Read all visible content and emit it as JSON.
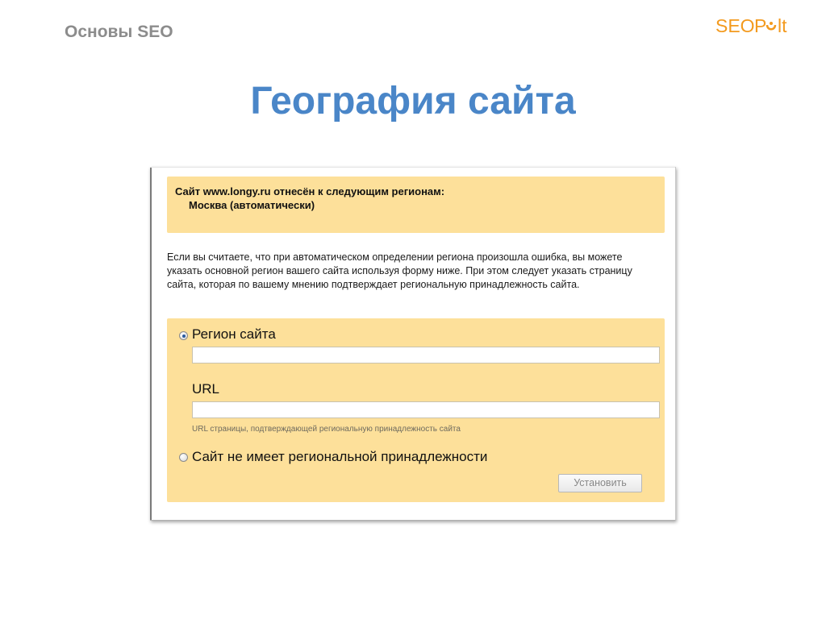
{
  "header": {
    "label": "Основы SEO",
    "logo": "SEOPult"
  },
  "slide": {
    "title": "География сайта"
  },
  "info": {
    "title": "Сайт www.longy.ru отнесён к следующим регионам:",
    "region": "Москва (автоматически)"
  },
  "description": "Если вы считаете, что при автоматическом определении региона произошла ошибка, вы можете указать основной регион вашего сайта используя форму ниже. При этом следует указать страницу сайта, которая по вашему мнению подтверждает региональную принадлежность сайта.",
  "form": {
    "region_option_label": "Регион сайта",
    "region_option_checked": true,
    "region_value": "",
    "url_label": "URL",
    "url_value": "",
    "url_hint": "URL страницы, подтверждающей региональную принадлежность сайта",
    "no_region_option_label": "Сайт не имеет региональной принадлежности",
    "no_region_option_checked": false,
    "submit_label": "Установить"
  },
  "colors": {
    "title": "#4a86c8",
    "header_label": "#8c8c8c",
    "panel_background": "#fde09a",
    "logo_orange": "#f39a1e"
  }
}
